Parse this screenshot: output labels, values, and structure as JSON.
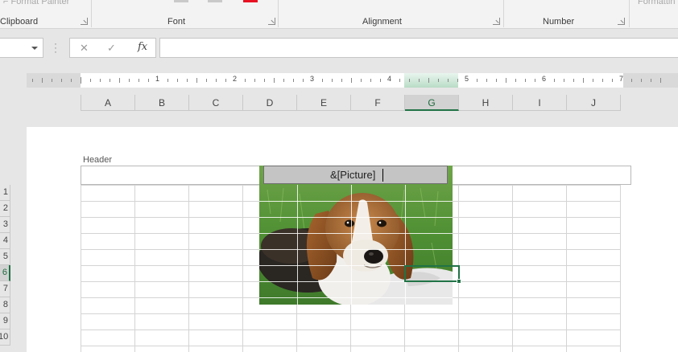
{
  "ribbon": {
    "format_painter_label": "Format Painter",
    "formatting_label": "Formattin",
    "groups": {
      "clipboard": "Clipboard",
      "font": "Font",
      "alignment": "Alignment",
      "number": "Number"
    },
    "accent_color": "#e81123"
  },
  "formula_bar": {
    "name_box_value": "",
    "cancel_icon": "close-icon",
    "enter_icon": "check-icon",
    "fx_label": "fx",
    "formula_value": ""
  },
  "ruler": {
    "numbers": [
      "1",
      "2",
      "3",
      "4",
      "5",
      "6",
      "7"
    ]
  },
  "columns": [
    "A",
    "B",
    "C",
    "D",
    "E",
    "F",
    "G",
    "H",
    "I",
    "J"
  ],
  "selected_column": "G",
  "rows": [
    "1",
    "2",
    "3",
    "4",
    "5",
    "6",
    "7",
    "8",
    "9",
    "10"
  ],
  "selected_row": "6",
  "page_header": {
    "label": "Header",
    "center_text": "&[Picture]"
  },
  "picture": {
    "subject": "beagle-puppy-photo"
  },
  "colors": {
    "selection_green": "#217346",
    "header_field_bg": "#c4c4c4",
    "grid_line": "#d4d4d4"
  }
}
